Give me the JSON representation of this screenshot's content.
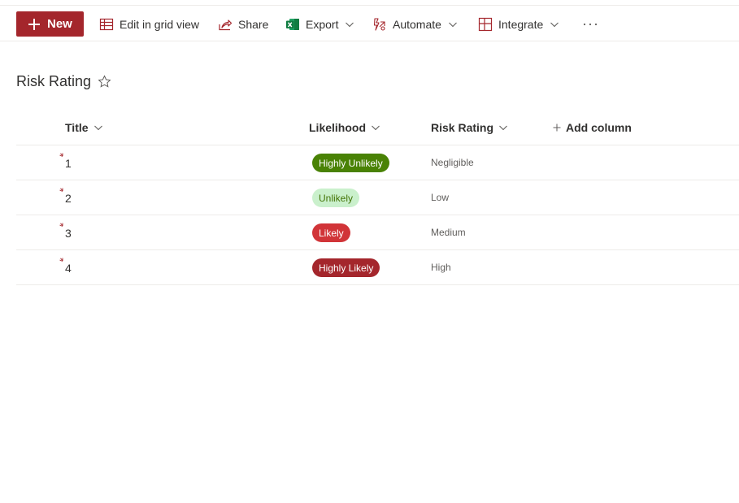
{
  "toolbar": {
    "new_label": "New",
    "edit_grid_label": "Edit in grid view",
    "share_label": "Share",
    "export_label": "Export",
    "automate_label": "Automate",
    "integrate_label": "Integrate",
    "more_label": "···"
  },
  "list": {
    "title": "Risk Rating"
  },
  "columns": {
    "title": "Title",
    "likelihood": "Likelihood",
    "risk_rating": "Risk Rating",
    "add_column": "Add column"
  },
  "rows": [
    {
      "title": "1",
      "likelihood": "Highly Unlikely",
      "likelihood_bg": "#498205",
      "likelihood_fg": "#ffffff",
      "risk_rating": "Negligible"
    },
    {
      "title": "2",
      "likelihood": "Unlikely",
      "likelihood_bg": "#caf0cc",
      "likelihood_fg": "#437406",
      "risk_rating": "Low"
    },
    {
      "title": "3",
      "likelihood": "Likely",
      "likelihood_bg": "#d13438",
      "likelihood_fg": "#ffffff",
      "risk_rating": "Medium"
    },
    {
      "title": "4",
      "likelihood": "Highly Likely",
      "likelihood_bg": "#a4262c",
      "likelihood_fg": "#ffffff",
      "risk_rating": "High"
    }
  ],
  "colors": {
    "accent": "#a4262c",
    "excel_green": "#107c41"
  },
  "icons": {
    "new": "plus-icon",
    "edit_grid": "grid-icon",
    "share": "share-icon",
    "export": "excel-icon",
    "automate": "automate-icon",
    "integrate": "integrate-icon",
    "favorite": "star-icon",
    "new_item": "new-item-indicator-icon"
  }
}
